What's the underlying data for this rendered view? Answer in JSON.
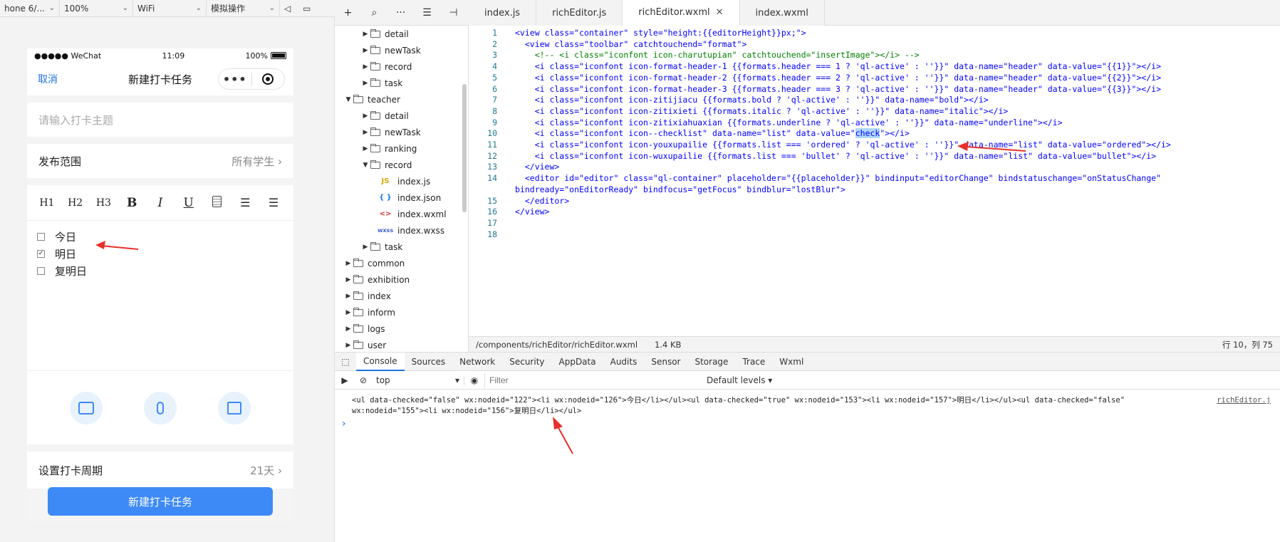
{
  "sim_toolbar": {
    "device": "hone 6/...",
    "zoom": "100%",
    "network": "WiFi",
    "operation": "模拟操作"
  },
  "phone": {
    "status": {
      "carrier": "●●●●● WeChat",
      "time": "11:09",
      "battery": "100%"
    },
    "nav": {
      "cancel": "取消",
      "title": "新建打卡任务"
    },
    "topic_placeholder": "请输入打卡主题",
    "scope": {
      "label": "发布范围",
      "value": "所有学生"
    },
    "toolbar": [
      "H1",
      "H2",
      "H3",
      "B",
      "I",
      "U"
    ],
    "checklist": [
      {
        "label": "今日",
        "checked": false
      },
      {
        "label": "明日",
        "checked": true
      },
      {
        "label": "复明日",
        "checked": false
      }
    ],
    "period": {
      "label": "设置打卡周期",
      "value": "21天"
    },
    "submit": "新建打卡任务"
  },
  "tree": [
    {
      "name": "detail",
      "type": "folder",
      "level": 2,
      "open": false
    },
    {
      "name": "newTask",
      "type": "folder",
      "level": 2,
      "open": false
    },
    {
      "name": "record",
      "type": "folder",
      "level": 2,
      "open": false
    },
    {
      "name": "task",
      "type": "folder",
      "level": 2,
      "open": false
    },
    {
      "name": "teacher",
      "type": "folder",
      "level": 1,
      "open": true
    },
    {
      "name": "detail",
      "type": "folder",
      "level": 2,
      "open": false
    },
    {
      "name": "newTask",
      "type": "folder",
      "level": 2,
      "open": false
    },
    {
      "name": "ranking",
      "type": "folder",
      "level": 2,
      "open": false
    },
    {
      "name": "record",
      "type": "folder",
      "level": 2,
      "open": true
    },
    {
      "name": "index.js",
      "type": "js",
      "level": 3
    },
    {
      "name": "index.json",
      "type": "json",
      "level": 3
    },
    {
      "name": "index.wxml",
      "type": "wxml",
      "level": 3
    },
    {
      "name": "index.wxss",
      "type": "wxss",
      "level": 3
    },
    {
      "name": "task",
      "type": "folder",
      "level": 2,
      "open": false
    },
    {
      "name": "common",
      "type": "folder",
      "level": 1,
      "open": false
    },
    {
      "name": "exhibition",
      "type": "folder",
      "level": 1,
      "open": false
    },
    {
      "name": "index",
      "type": "folder",
      "level": 1,
      "open": false
    },
    {
      "name": "inform",
      "type": "folder",
      "level": 1,
      "open": false
    },
    {
      "name": "logs",
      "type": "folder",
      "level": 1,
      "open": false
    },
    {
      "name": "user",
      "type": "folder",
      "level": 1,
      "open": false
    }
  ],
  "tabs": [
    {
      "label": "index.js",
      "active": false
    },
    {
      "label": "richEditor.js",
      "active": false
    },
    {
      "label": "richEditor.wxml",
      "active": true
    },
    {
      "label": "index.wxml",
      "active": false
    }
  ],
  "code_lines": [
    {
      "n": "1",
      "text": "<view class=\"container\" style=\"height:{{editorHeight}}px;\">",
      "kind": "tag"
    },
    {
      "n": "2",
      "text": "  <view class=\"toolbar\" catchtouchend=\"format\">",
      "kind": "tag"
    },
    {
      "n": "3",
      "text": "    <!-- <i class=\"iconfont icon-charutupian\" catchtouchend=\"insertImage\"></i> -->",
      "kind": "comment"
    },
    {
      "n": "4",
      "text": "    <i class=\"iconfont icon-format-header-1 {{formats.header === 1 ? 'ql-active' : ''}}\" data-name=\"header\" data-value=\"{{1}}\"></i>",
      "kind": "tag"
    },
    {
      "n": "5",
      "text": "    <i class=\"iconfont icon-format-header-2 {{formats.header === 2 ? 'ql-active' : ''}}\" data-name=\"header\" data-value=\"{{2}}\"></i>",
      "kind": "tag"
    },
    {
      "n": "6",
      "text": "    <i class=\"iconfont icon-format-header-3 {{formats.header === 3 ? 'ql-active' : ''}}\" data-name=\"header\" data-value=\"{{3}}\"></i>",
      "kind": "tag"
    },
    {
      "n": "7",
      "text": "    <i class=\"iconfont icon-zitijiacu {{formats.bold ? 'ql-active' : ''}}\" data-name=\"bold\"></i>",
      "kind": "tag"
    },
    {
      "n": "8",
      "text": "    <i class=\"iconfont icon-zitixieti {{formats.italic ? 'ql-active' : ''}}\" data-name=\"italic\"></i>",
      "kind": "tag"
    },
    {
      "n": "9",
      "text": "    <i class=\"iconfont icon-zitixiahuaxian {{formats.underline ? 'ql-active' : ''}}\" data-name=\"underline\"></i>",
      "kind": "tag"
    },
    {
      "n": "10",
      "text_before": "    <i class=\"iconfont icon--checklist\" data-name=\"list\" data-value=\"",
      "highlight": "check",
      "text_after": "\"></i>",
      "kind": "tag"
    },
    {
      "n": "11",
      "text": "    <i class=\"iconfont icon-youxupailie {{formats.list === 'ordered' ? 'ql-active' : ''}}\" data-name=\"list\" data-value=\"ordered\"></i>",
      "kind": "tag"
    },
    {
      "n": "12",
      "text": "    <i class=\"iconfont icon-wuxupailie {{formats.list === 'bullet' ? 'ql-active' : ''}}\" data-name=\"list\" data-value=\"bullet\"></i>",
      "kind": "tag"
    },
    {
      "n": "13",
      "text": "  </view>",
      "kind": "tag"
    },
    {
      "n": "14",
      "text": "  <editor id=\"editor\" class=\"ql-container\" placeholder=\"{{placeholder}}\" bindinput=\"editorChange\" bindstatuschange=\"onStatusChange\"",
      "kind": "tag"
    },
    {
      "n": "",
      "text": "bindready=\"onEditorReady\" bindfocus=\"getFocus\" bindblur=\"lostBlur\">",
      "kind": "tag"
    },
    {
      "n": "15",
      "text": "  </editor>",
      "kind": "tag"
    },
    {
      "n": "16",
      "text": "</view>",
      "kind": "tag"
    },
    {
      "n": "17",
      "text": "",
      "kind": "tag"
    },
    {
      "n": "18",
      "text": "",
      "kind": "tag"
    }
  ],
  "status_bar": {
    "path": "/components/richEditor/richEditor.wxml",
    "size": "1.4 KB",
    "position": "行 10，列 75"
  },
  "devtools": {
    "tabs": [
      "Console",
      "Sources",
      "Network",
      "Security",
      "AppData",
      "Audits",
      "Sensor",
      "Storage",
      "Trace",
      "Wxml"
    ],
    "active_tab": "Console",
    "context": "top",
    "filter_placeholder": "Filter",
    "levels": "Default levels ▾",
    "message_line1": "<ul data-checked=\"false\" wx:nodeid=\"122\"><li wx:nodeid=\"126\">今日</li></ul><ul data-checked=\"true\" wx:nodeid=\"153\"><li wx:nodeid=\"157\">明日</li></ul><ul data-checked=\"false\"",
    "message_line2": "wx:nodeid=\"155\"><li wx:nodeid=\"156\">复明日</li></ul>",
    "source_link": "richEditor.j",
    "prompt": "›"
  },
  "colors": {
    "accent": "#1a73e8",
    "button": "#3d8af7",
    "arrow": "#e8302a",
    "code_tag": "#0000ff",
    "code_comment": "#008000"
  }
}
